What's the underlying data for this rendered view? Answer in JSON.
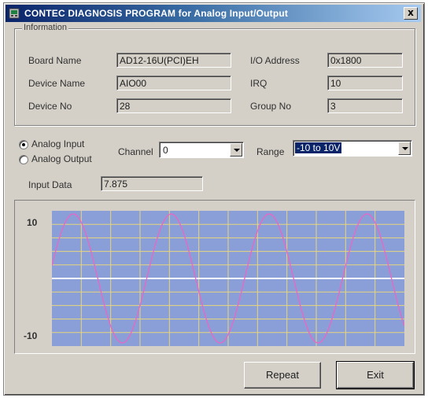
{
  "window": {
    "title": "CONTEC DIAGNOSIS PROGRAM for Analog Input/Output",
    "close_glyph": "x"
  },
  "information": {
    "legend": "Information",
    "board_name_label": "Board Name",
    "board_name_value": "AD12-16U(PCI)EH",
    "device_name_label": "Device Name",
    "device_name_value": "AIO00",
    "device_no_label": "Device No",
    "device_no_value": "28",
    "io_address_label": "I/O Address",
    "io_address_value": "0x1800",
    "irq_label": "IRQ",
    "irq_value": "10",
    "group_no_label": "Group No",
    "group_no_value": "3"
  },
  "mode": {
    "analog_input_label": "Analog Input",
    "analog_output_label": "Analog Output",
    "selected": "analog_input"
  },
  "channel": {
    "label": "Channel",
    "value": "0"
  },
  "range": {
    "label": "Range",
    "value": "-10 to 10V"
  },
  "input_data": {
    "label": "Input Data",
    "value": "7.875"
  },
  "plot": {
    "ymax_label": "10",
    "ymin_label": "-10",
    "y_range": [
      -10,
      10
    ],
    "cycles": 3.6,
    "background": "#8a9ed8",
    "grid_color": "#e8d67a",
    "wave_color": "#e46ac4",
    "center_line_color": "#ffffff"
  },
  "buttons": {
    "repeat": "Repeat",
    "exit": "Exit"
  },
  "icons": {
    "app": "app-icon",
    "close": "close-icon",
    "dropdown": "chevron-down-icon"
  }
}
